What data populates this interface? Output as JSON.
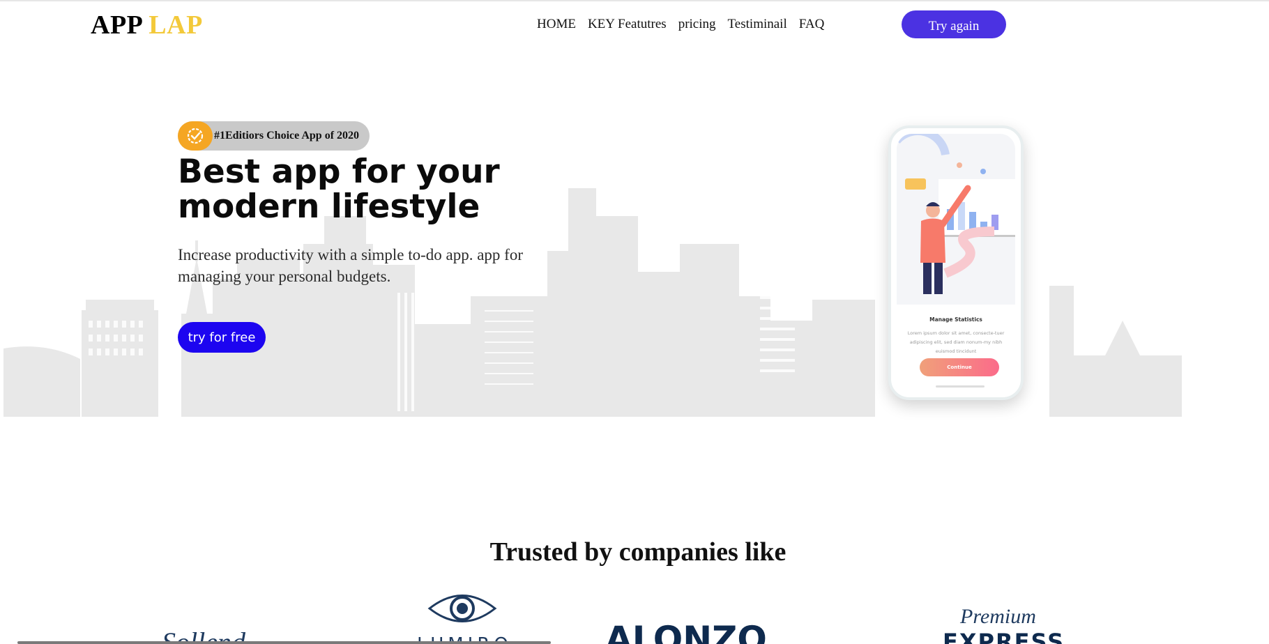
{
  "header": {
    "logo_part1": "APP",
    "logo_part2": "LAP",
    "nav": [
      "HOME",
      "KEY Featutres",
      "pricing",
      "Testiminail",
      "FAQ"
    ],
    "cta": "Try again"
  },
  "hero": {
    "badge_icon": "verified-check-icon",
    "badge_text": "#1Editiors Choice App of 2020",
    "title": "Best app for your modern lifestyle",
    "description": "Increase productivity with a simple to-do app. app for managing your personal budgets.",
    "cta": "try for free"
  },
  "phone": {
    "screen_title": "Manage Statistics",
    "screen_body": "Lorem ipsum dolor sit amet, consecte-tuer adipiscing elit, sed diam nonum-my nibh euismod tincidunt",
    "screen_button": "Continue"
  },
  "trusted": {
    "heading": "Trusted by companies like",
    "logos": [
      {
        "name": "italic-script-logo",
        "text": "Sollend"
      },
      {
        "name": "eye-logo",
        "text": "LUMIRO"
      },
      {
        "name": "alonzo-logo",
        "text": "ALONZO"
      },
      {
        "name": "premium-express-logo",
        "text_top": "Premium",
        "text_bottom": "EXPRESS"
      }
    ]
  },
  "colors": {
    "logo_accent": "#f3c93a",
    "header_button": "#4b32e2",
    "primary_button": "#1d05f0",
    "badge_icon_bg": "#f5a623",
    "badge_bg": "#c9c9c9",
    "skyline": "#e8e8e8"
  }
}
